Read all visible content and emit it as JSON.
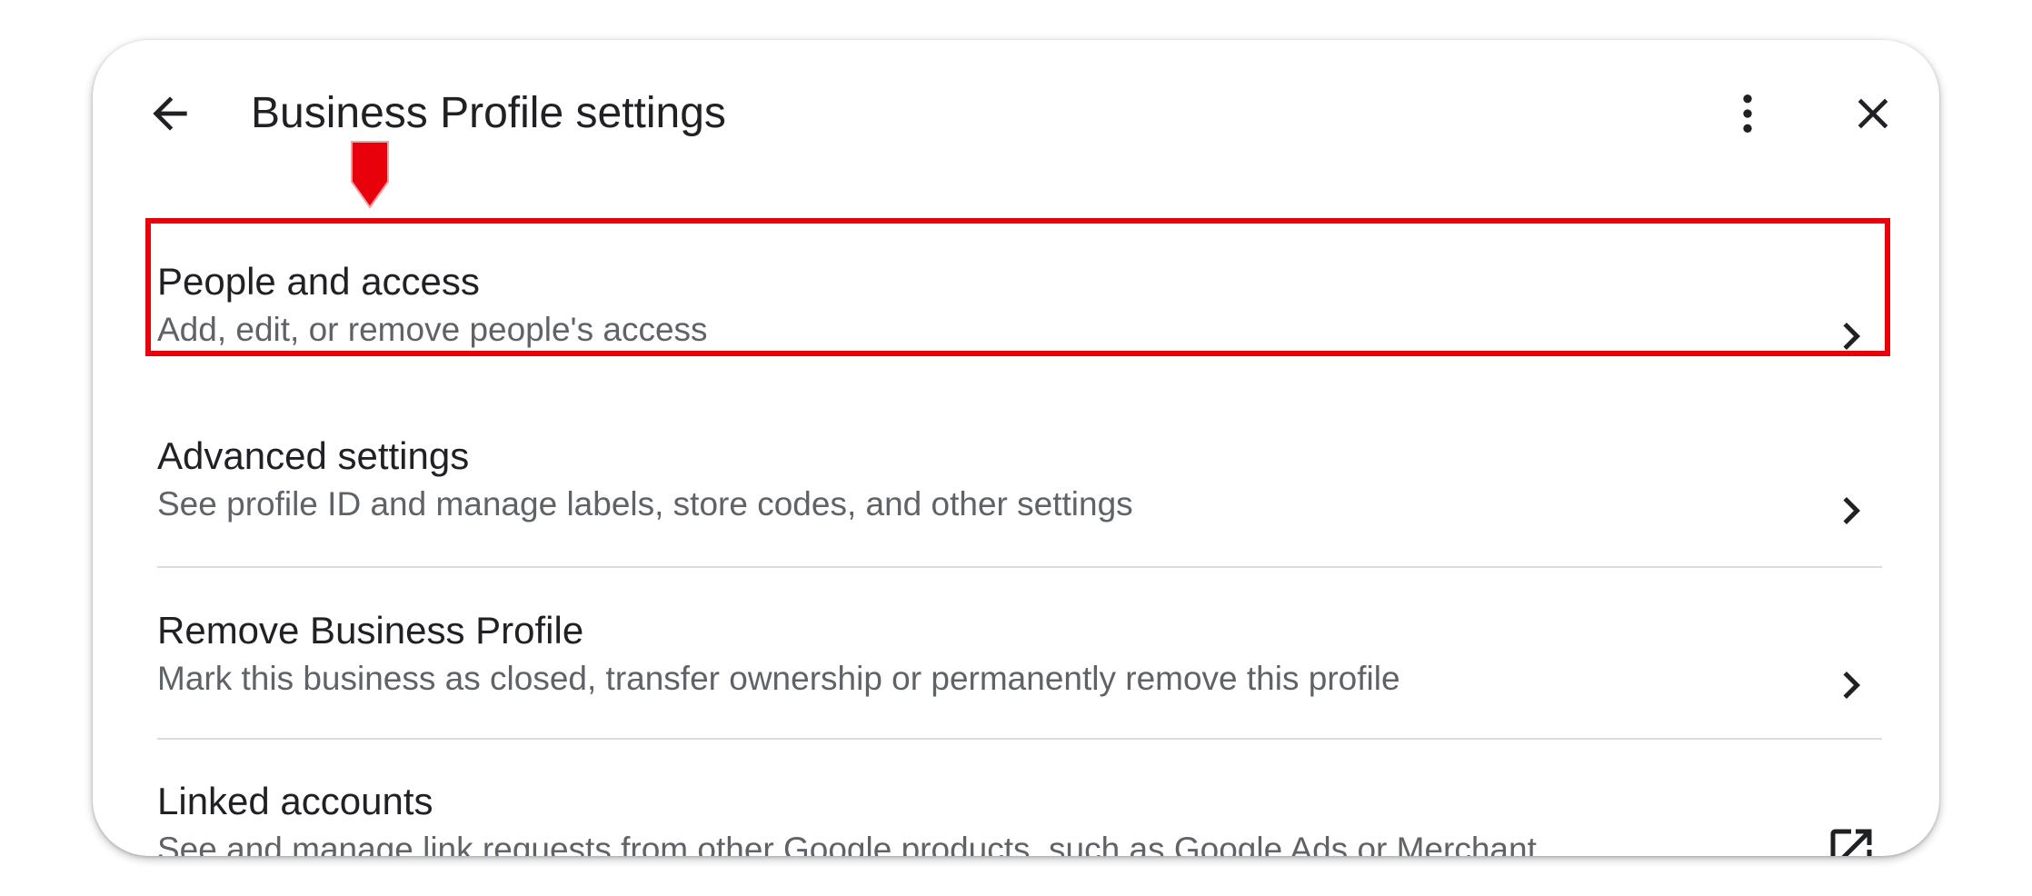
{
  "header": {
    "title": "Business Profile settings",
    "back_icon": "arrow-back-icon",
    "more_icon": "more-vert-icon",
    "close_icon": "close-icon"
  },
  "annotation": {
    "highlight_color": "#e8000b",
    "pointer_icon": "down-arrow-marker-icon"
  },
  "settings": {
    "items": [
      {
        "title": "People and access",
        "subtitle": "Add, edit, or remove people's access",
        "trailing_icon": "chevron-right-icon",
        "highlighted": true
      },
      {
        "title": "Advanced settings",
        "subtitle": "See profile ID and manage labels, store codes, and other settings",
        "trailing_icon": "chevron-right-icon"
      },
      {
        "title": "Remove Business Profile",
        "subtitle": "Mark this business as closed, transfer ownership or permanently remove this profile",
        "trailing_icon": "chevron-right-icon"
      },
      {
        "title": "Linked accounts",
        "subtitle": "See and manage link requests from other Google products, such as Google Ads or Merchant",
        "trailing_icon": "open-in-new-icon"
      }
    ]
  }
}
